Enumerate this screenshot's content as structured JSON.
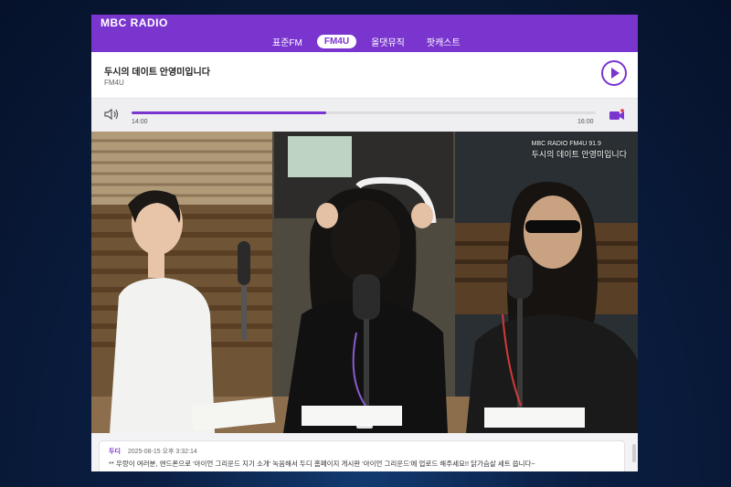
{
  "app": {
    "logo": "MBC RADIO"
  },
  "tabs": [
    {
      "label": "표준FM",
      "active": false
    },
    {
      "label": "FM4U",
      "active": true
    },
    {
      "label": "올댓뮤직",
      "active": false
    },
    {
      "label": "팟캐스트",
      "active": false
    }
  ],
  "now_playing": {
    "title": "두시의 데이트 안영미입니다",
    "channel": "FM4U"
  },
  "player": {
    "start_time": "14:00",
    "end_time": "16:00",
    "progress": 0.42
  },
  "video_overlay": {
    "line1": "MBC RADIO FM4U 91.9",
    "line2": "두시의 데이트 안영미입니다"
  },
  "comment": {
    "author": "두디",
    "timestamp": "2025-08-15 오후 3:32:14",
    "text": "** 우랑이 여러분, 앤드폰으로 '아이언 그리운드 지기 소개' 녹음해서 두디 홈페이지 게시판 '아이언 그리운드'에 업로드 해주세요!! 닭가슴살 세트 씁니다~"
  },
  "colors": {
    "accent": "#7a35cf"
  }
}
